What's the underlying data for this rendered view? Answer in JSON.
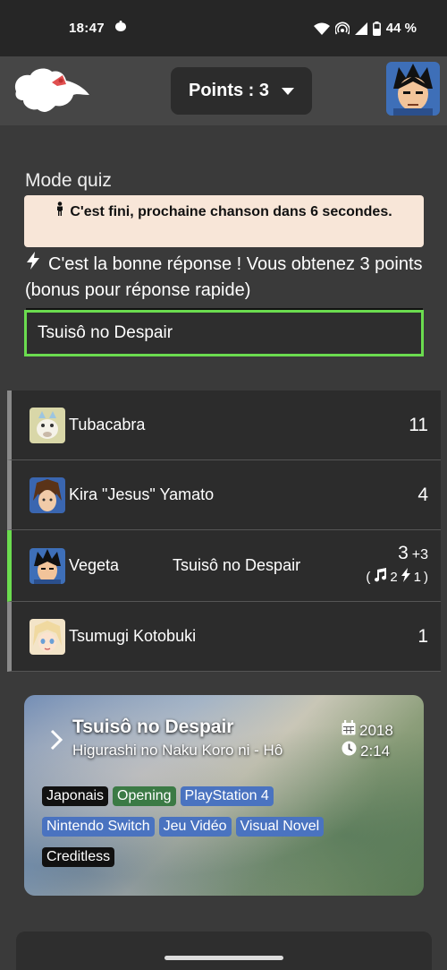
{
  "status_bar": {
    "time": "18:47",
    "battery": "44 %",
    "icons": [
      "notification-icon",
      "wifi-icon",
      "hotspot-icon",
      "signal-icon",
      "battery-icon"
    ]
  },
  "header": {
    "points_label": "Points : 3",
    "logo_icon": "mascot-logo",
    "avatar_icon": "user-avatar"
  },
  "quiz": {
    "mode_title": "Mode quiz",
    "alert_text": "C'est fini, prochaine chanson dans 6 secondes.",
    "result_text": "C'est la bonne réponse ! Vous obtenez 3 points (bonus pour réponse rapide)",
    "answer_value": "Tsuisô no Despair"
  },
  "players": [
    {
      "name": "Tubacabra",
      "score": "11",
      "answer": "",
      "active": false
    },
    {
      "name": "Kira \"Jesus\" Yamato",
      "score": "4",
      "answer": "",
      "active": false
    },
    {
      "name": "Vegeta",
      "score": "3",
      "bonus": "+3",
      "answer": "Tsuisô no Despair",
      "music_points": "2",
      "speed_points": "1",
      "active": true
    },
    {
      "name": "Tsumugi Kotobuki",
      "score": "1",
      "answer": "",
      "active": false
    }
  ],
  "song": {
    "title": "Tsuisô no Despair",
    "subtitle": "Higurashi no Naku Koro ni - Hô",
    "year": "2018",
    "duration": "2:14",
    "tags_row1": [
      "Japonais",
      "Opening",
      "PlayStation 4"
    ],
    "tags_row2": [
      "Nintendo Switch",
      "Jeu Vidéo",
      "Visual Novel"
    ],
    "tags_row3": [
      "Creditless"
    ]
  },
  "colors": {
    "accent_green": "#6bdc4f",
    "alert_bg": "#f8e6d8",
    "tag_green": "#3b7a45",
    "tag_blue": "#4a73c0"
  }
}
